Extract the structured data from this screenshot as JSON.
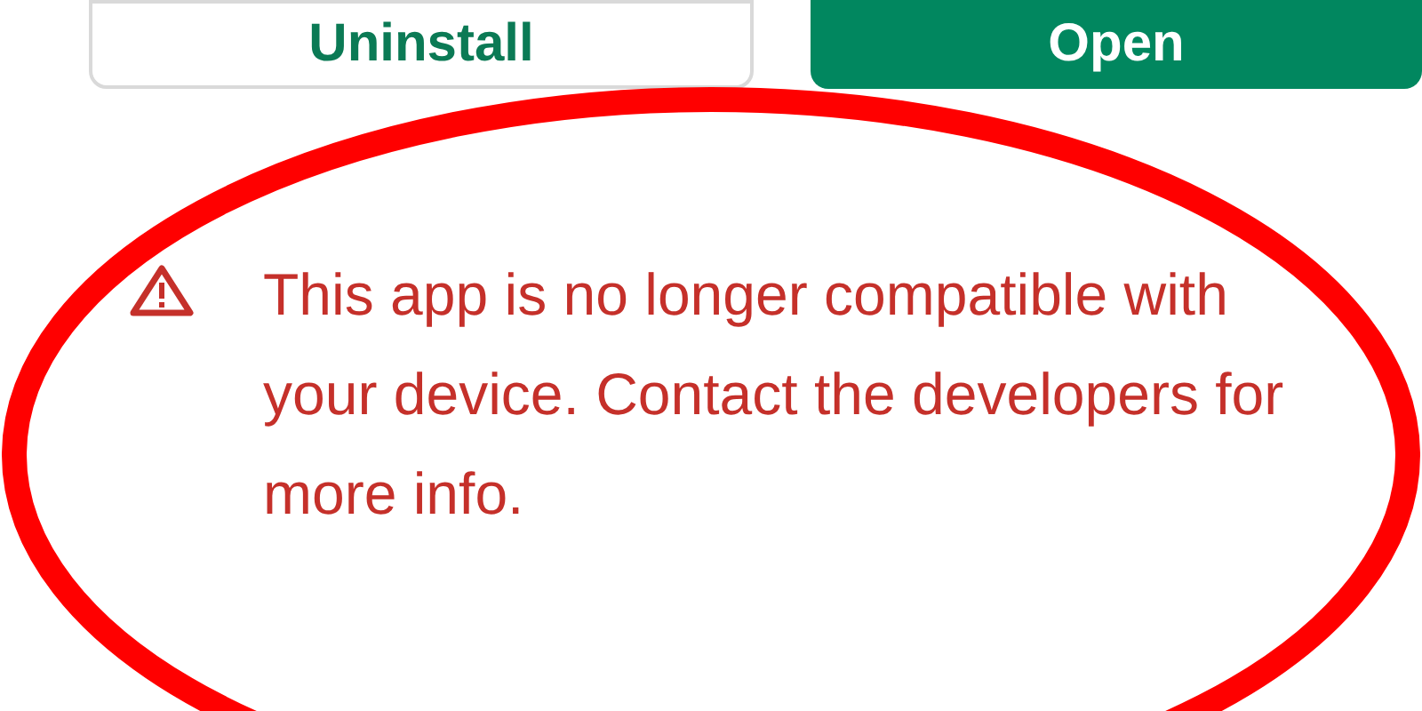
{
  "buttons": [
    {
      "label": "Uninstall",
      "kind": "outlined"
    },
    {
      "label": "Open",
      "kind": "filled"
    }
  ],
  "warning": {
    "message": "This app is no longer compatible with your device. Contact the developers for more info."
  }
}
